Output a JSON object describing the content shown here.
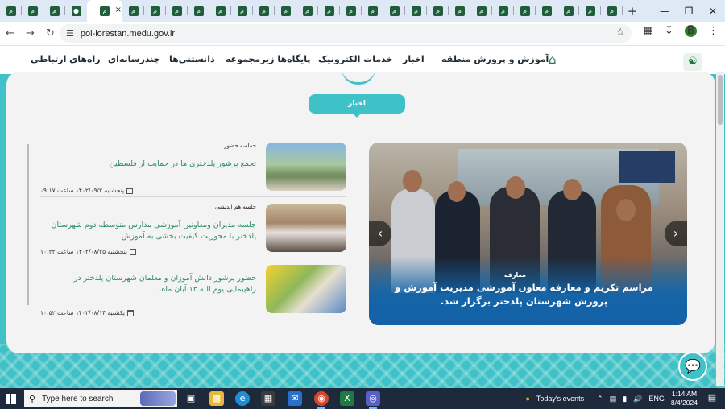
{
  "browser": {
    "tab_count_left": 4,
    "tab_count_right": 23,
    "tab_glyph": "م",
    "active_tab_close": "×",
    "new_tab": "+",
    "url": "pol-lorestan.medu.gov.ir",
    "window_controls": {
      "minimize": "—",
      "restore": "❐",
      "close": "✕"
    },
    "profile_initial": "B"
  },
  "site": {
    "nav": {
      "home_icon": "home-icon",
      "items": [
        "آموزش و پرورش منطقه",
        "اخبار",
        "خدمات الکترونیک",
        "پایگاه‌ها زیرمجموعه",
        "دانستنی‌ها",
        "چندرسانه‌ای",
        "راه‌های ارتباطی"
      ]
    },
    "section_label": "اخبار",
    "slider": {
      "category": "معارفه",
      "title": "مراسم تکریم و معارفه معاون آموزشی مدیریت آموزش و پرورش شهرستان پلدختر برگزار شد.",
      "prev": "‹",
      "next": "›"
    },
    "news": [
      {
        "category": "حماسه حضور",
        "title": "تجمع پرشور پلدختری ها در حمایت از فلسطین",
        "date": "پنجشنبه ۱۴۰۲/۰۹/۲ ساعت ۰۹:۱۷"
      },
      {
        "category": "جلسه هم اندیشی",
        "title": "جلسه مدیران ومعاونین آموزشی مدارس متوسطه دوم شهرستان پلدختر با محوریت کیفیت بخشی به آموزش",
        "date": "پنجشنبه ۱۴۰۲/۰۸/۲۵ ساعت ۱۰:۲۲"
      },
      {
        "category": "",
        "title": "حضور پرشور دانش آموزان و معلمان شهرستان پلدختر در راهپیمایی یوم الله ۱۳ آبان ماه.",
        "date": "یکشنبه ۱۴۰۲/۰۸/۱۴ ساعت ۱۰:۵۲"
      }
    ]
  },
  "taskbar": {
    "search_placeholder": "Type here to search",
    "weather_label": "Today's events",
    "language": "ENG",
    "time": "1:14 AM",
    "date": "8/4/2024"
  }
}
